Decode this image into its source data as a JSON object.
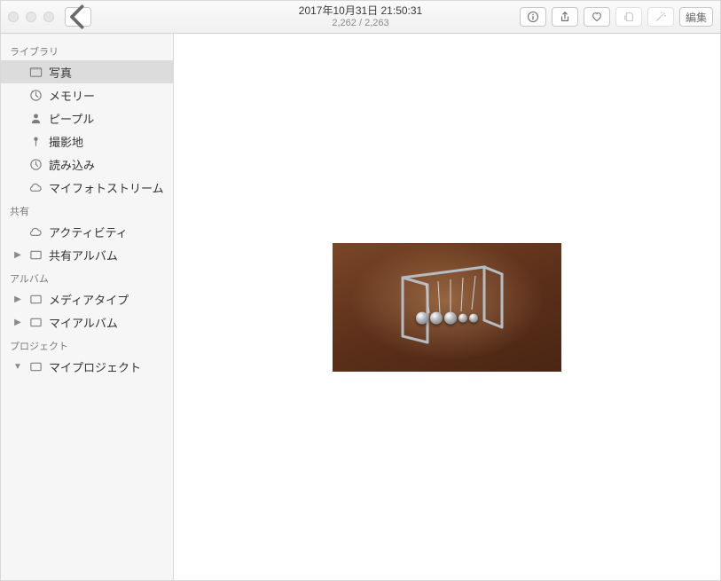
{
  "titlebar": {
    "date": "2017年10月31日 21:50:31",
    "counter": "2,262 / 2,263",
    "edit_label": "編集"
  },
  "sidebar": {
    "sections": {
      "library": {
        "header": "ライブラリ",
        "items": [
          {
            "label": "写真"
          },
          {
            "label": "メモリー"
          },
          {
            "label": "ピープル"
          },
          {
            "label": "撮影地"
          },
          {
            "label": "読み込み"
          },
          {
            "label": "マイフォトストリーム"
          }
        ]
      },
      "shared": {
        "header": "共有",
        "items": [
          {
            "label": "アクティビティ"
          },
          {
            "label": "共有アルバム"
          }
        ]
      },
      "albums": {
        "header": "アルバム",
        "items": [
          {
            "label": "メディアタイプ"
          },
          {
            "label": "マイアルバム"
          }
        ]
      },
      "projects": {
        "header": "プロジェクト",
        "items": [
          {
            "label": "マイプロジェクト"
          }
        ]
      }
    }
  }
}
